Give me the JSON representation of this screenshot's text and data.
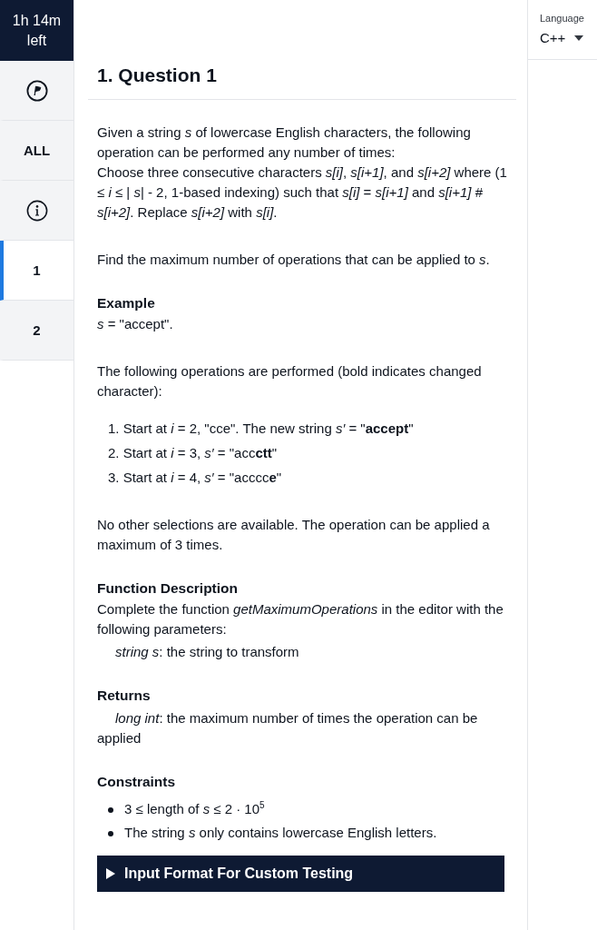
{
  "sidebar": {
    "timer": "1h 14m left",
    "items": [
      {
        "kind": "flag",
        "selected": false
      },
      {
        "kind": "label",
        "label": "ALL",
        "selected": false
      },
      {
        "kind": "info",
        "selected": false
      },
      {
        "kind": "label",
        "label": "1",
        "selected": true
      },
      {
        "kind": "label",
        "label": "2",
        "selected": false
      }
    ]
  },
  "language_picker": {
    "label": "Language",
    "value": "C++"
  },
  "question": {
    "title": "1. Question 1",
    "blocks": [
      {
        "kind": "paragraph",
        "lines": [
          "Given a string *s* of lowercase English characters, the following operation can be performed any number of times:",
          "Choose three consecutive characters *s[i]*, *s[i+1]*, and *s[i+2]* where (1 ≤ *i* ≤ | *s*| - 2, 1-based indexing) such that *s[i]* = *s[i+1]* and *s[i+1]* # *s[i+2]*. Replace *s[i+2]* with *s[i]*."
        ]
      },
      {
        "kind": "paragraph",
        "lines": [
          "Find the maximum number of operations that can be applied to *s*."
        ]
      },
      {
        "kind": "heading",
        "text": "Example"
      },
      {
        "kind": "text",
        "lines": [
          "*s* = \"accept\"."
        ]
      },
      {
        "kind": "paragraph",
        "lines": [
          "The following operations are performed (bold indicates changed character):"
        ]
      },
      {
        "kind": "steps",
        "items": [
          {
            "number": "1.",
            "text": "Start at *i* = 2, \"cce\". The new string *s′* = \"**accept**\""
          },
          {
            "number": "2.",
            "text": "Start at *i* = 3, *s′* = \"acc**ctt**\""
          },
          {
            "number": "3.",
            "text": "Start at *i* = 4, *s′* = \"acccc**e**\""
          }
        ]
      },
      {
        "kind": "paragraph",
        "lines": [
          "No other selections are available. The operation can be applied a maximum of 3 times."
        ]
      },
      {
        "kind": "heading",
        "text": "Function Description"
      },
      {
        "kind": "text",
        "lines": [
          "Complete the function *getMaximumOperations* in the editor with the following parameters:"
        ]
      },
      {
        "kind": "indented",
        "text": "*string s*: the string to transform"
      },
      {
        "kind": "heading",
        "text": "Returns"
      },
      {
        "kind": "indented",
        "text": "*long int*: the maximum number of times the operation can be applied"
      },
      {
        "kind": "heading",
        "text": "Constraints"
      },
      {
        "kind": "bullets",
        "items": [
          "3 ≤ length of *s* ≤ 2 · 10$^{5}$",
          "The string *s* only contains lowercase English letters."
        ]
      }
    ],
    "custom_testing": {
      "label": "Input Format For Custom Testing",
      "expanded": false
    }
  }
}
